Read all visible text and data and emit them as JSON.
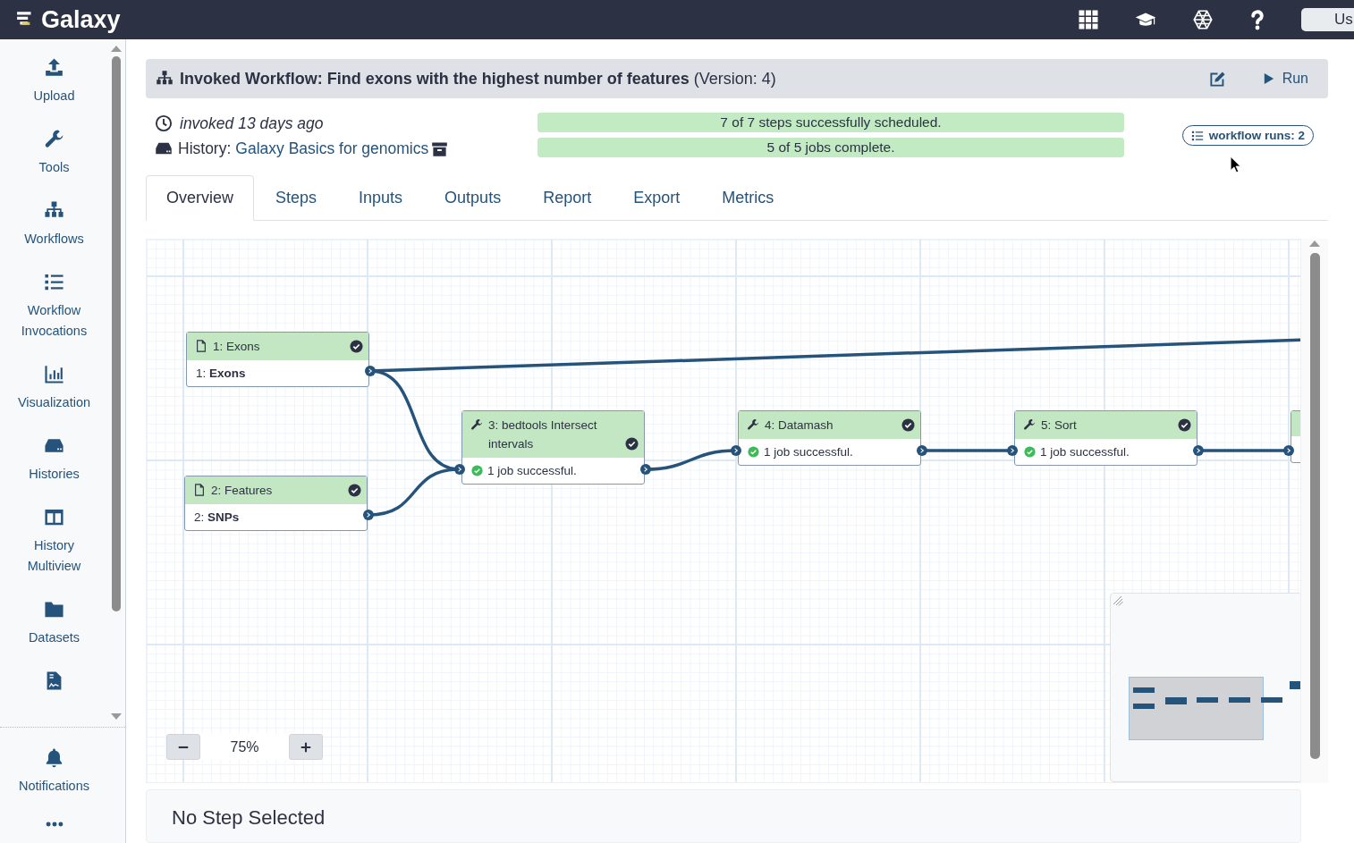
{
  "topbar": {
    "brand": "Galaxy",
    "user_button": "Us"
  },
  "sidebar": {
    "items": [
      {
        "label": "Upload"
      },
      {
        "label": "Tools"
      },
      {
        "label": "Workflows"
      },
      {
        "label": "Workflow Invocations"
      },
      {
        "label": "Visualization"
      },
      {
        "label": "Histories"
      },
      {
        "label": "History Multiview"
      },
      {
        "label": "Datasets"
      }
    ],
    "bottom_items": [
      {
        "label": "Notifications"
      }
    ]
  },
  "invocation": {
    "title": "**Invoked Workflow: Find exons with the highest number of features** (Version: 4)",
    "run_button": "Run",
    "invoked": "invoked 13 days ago",
    "history_label": "History:",
    "history_link": "Galaxy Basics for genomics",
    "progress": [
      {
        "text": "7 of 7 steps successfully scheduled.",
        "level": 1
      },
      {
        "text": "5 of 5 jobs complete.",
        "level": 1
      }
    ],
    "runs_badge": "workflow runs: 2"
  },
  "tabs": [
    {
      "label": "Overview",
      "selected": true
    },
    {
      "label": "Steps",
      "selected": false
    },
    {
      "label": "Inputs",
      "selected": false
    },
    {
      "label": "Outputs",
      "selected": false
    },
    {
      "label": "Report",
      "selected": false
    },
    {
      "label": "Export",
      "selected": false
    },
    {
      "label": "Metrics",
      "selected": false
    }
  ],
  "graph": {
    "nodes": [
      {
        "kind": "input",
        "title": "1: Exons",
        "done": true,
        "output_index": "1:",
        "output_name": "Exons"
      },
      {
        "kind": "input",
        "title": "2: Features",
        "done": true,
        "output_index": "2:",
        "output_name": "SNPs"
      },
      {
        "kind": "tool",
        "title": "3: bedtools Intersect intervals",
        "done": true,
        "status": "1 job successful."
      },
      {
        "kind": "tool",
        "title": "4: Datamash",
        "done": true,
        "status": "1 job successful."
      },
      {
        "kind": "tool",
        "title": "5: Sort",
        "done": true,
        "status": "1 job successful."
      }
    ],
    "zoom_level": "75%"
  },
  "details_panel": {
    "title": "No Step Selected"
  }
}
